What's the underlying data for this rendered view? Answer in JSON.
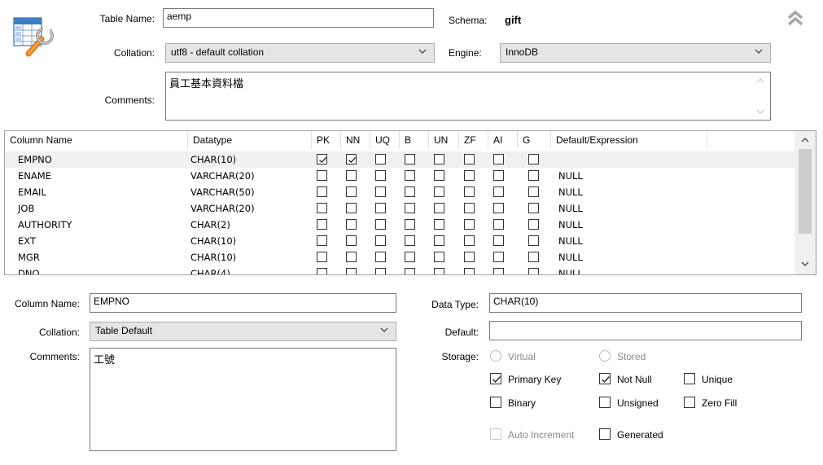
{
  "table": {
    "name_label": "Table Name:",
    "name_value": "aemp",
    "schema_label": "Schema:",
    "schema_value": "gift",
    "collation_label": "Collation:",
    "collation_value": "utf8 - default collation",
    "engine_label": "Engine:",
    "engine_value": "InnoDB",
    "comments_label": "Comments:",
    "comments_value": "員工基本資料檔"
  },
  "grid": {
    "headers": [
      "Column Name",
      "Datatype",
      "PK",
      "NN",
      "UQ",
      "B",
      "UN",
      "ZF",
      "AI",
      "G",
      "Default/Expression"
    ],
    "rows": [
      {
        "name": "EMPNO",
        "type": "CHAR(10)",
        "flags": [
          true,
          true,
          false,
          false,
          false,
          false,
          false,
          false
        ],
        "default": ""
      },
      {
        "name": "ENAME",
        "type": "VARCHAR(20)",
        "flags": [
          false,
          false,
          false,
          false,
          false,
          false,
          false,
          false
        ],
        "default": "NULL"
      },
      {
        "name": "EMAIL",
        "type": "VARCHAR(50)",
        "flags": [
          false,
          false,
          false,
          false,
          false,
          false,
          false,
          false
        ],
        "default": "NULL"
      },
      {
        "name": "JOB",
        "type": "VARCHAR(20)",
        "flags": [
          false,
          false,
          false,
          false,
          false,
          false,
          false,
          false
        ],
        "default": "NULL"
      },
      {
        "name": "AUTHORITY",
        "type": "CHAR(2)",
        "flags": [
          false,
          false,
          false,
          false,
          false,
          false,
          false,
          false
        ],
        "default": "NULL"
      },
      {
        "name": "EXT",
        "type": "CHAR(10)",
        "flags": [
          false,
          false,
          false,
          false,
          false,
          false,
          false,
          false
        ],
        "default": "NULL"
      },
      {
        "name": "MGR",
        "type": "CHAR(10)",
        "flags": [
          false,
          false,
          false,
          false,
          false,
          false,
          false,
          false
        ],
        "default": "NULL"
      },
      {
        "name": "DNO",
        "type": "CHAR(4)",
        "flags": [
          false,
          false,
          false,
          false,
          false,
          false,
          false,
          false
        ],
        "default": "NULL"
      }
    ]
  },
  "detail": {
    "column_name_label": "Column Name:",
    "column_name_value": "EMPNO",
    "data_type_label": "Data Type:",
    "data_type_value": "CHAR(10)",
    "collation_label": "Collation:",
    "collation_value": "Table Default",
    "default_label": "Default:",
    "default_value": "",
    "comments_label": "Comments:",
    "comments_value": "工號",
    "storage_label": "Storage:",
    "virtual_label": "Virtual",
    "stored_label": "Stored",
    "primary_key_label": "Primary Key",
    "not_null_label": "Not Null",
    "unique_label": "Unique",
    "binary_label": "Binary",
    "unsigned_label": "Unsigned",
    "zero_fill_label": "Zero Fill",
    "auto_increment_label": "Auto Increment",
    "generated_label": "Generated"
  }
}
